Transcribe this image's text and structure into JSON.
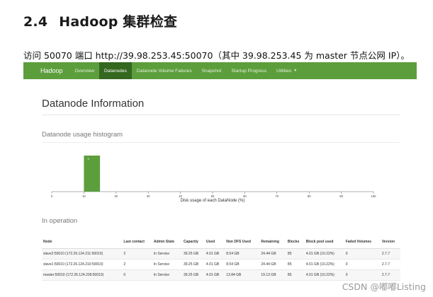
{
  "doc": {
    "section_number": "2.4",
    "section_title": "Hadoop 集群检查",
    "intro": "访问 50070 端口 http://39.98.253.45:50070（其中 39.98.253.45 为 master 节点公网 IP）。"
  },
  "nav": {
    "brand": "Hadoop",
    "items": [
      {
        "label": "Overview",
        "active": false
      },
      {
        "label": "Datanodes",
        "active": true
      },
      {
        "label": "Datanode Volume Failures",
        "active": false
      },
      {
        "label": "Snapshot",
        "active": false
      },
      {
        "label": "Startup Progress",
        "active": false
      },
      {
        "label": "Utilities",
        "active": false
      }
    ]
  },
  "page": {
    "heading": "Datanode Information",
    "histogram_heading": "Datanode usage histogram",
    "operation_heading": "In operation"
  },
  "chart_data": {
    "type": "bar",
    "xlabel": "Disk usage of each DataNode (%)",
    "xlim": [
      0,
      100
    ],
    "ticks": [
      0,
      10,
      20,
      30,
      40,
      50,
      60,
      70,
      80,
      90,
      100
    ],
    "bins": [
      {
        "x0": 10,
        "x1": 15,
        "count": 3
      }
    ],
    "bar_color": "#5c9e3c"
  },
  "table": {
    "columns": [
      "Node",
      "Last contact",
      "Admin State",
      "Capacity",
      "Used",
      "Non DFS Used",
      "Remaining",
      "Blocks",
      "Block pool used",
      "Failed Volumes",
      "Version"
    ],
    "rows": [
      [
        "slave2:50010 (172.26.124.211:50010)",
        "2",
        "In Service",
        "39.25 GB",
        "4.01 GB",
        "8.54 GB",
        "24.44 GB",
        "85",
        "4.01 GB (10.22%)",
        "0",
        "2.7.7"
      ],
      [
        "slave1:50010 (172.26.124.210:50010)",
        "2",
        "In Service",
        "39.25 GB",
        "4.01 GB",
        "8.54 GB",
        "24.44 GB",
        "85",
        "4.01 GB (10.22%)",
        "0",
        "2.7.7"
      ],
      [
        "master:50010 (172.26.124.209:50010)",
        "0",
        "In Service",
        "39.25 GB",
        "4.01 GB",
        "13.84 GB",
        "19.13 GB",
        "85",
        "4.01 GB (10.22%)",
        "0",
        "2.7.7"
      ]
    ]
  },
  "watermark": "CSDN @嘟嘟Listing"
}
